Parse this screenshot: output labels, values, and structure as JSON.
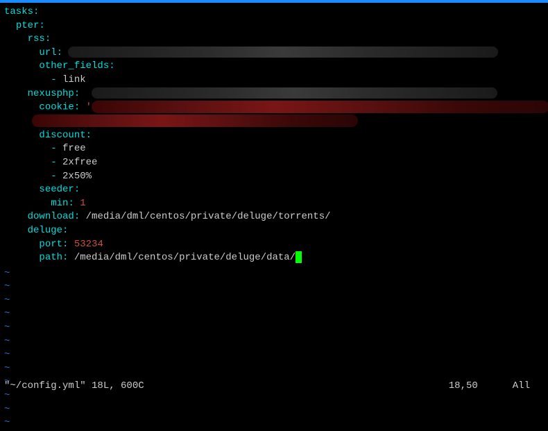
{
  "yaml": {
    "tasks": {
      "key": "tasks",
      "pter": {
        "key": "pter",
        "rss": {
          "key": "rss",
          "url": {
            "key": "url",
            "value": ""
          },
          "other_fields": {
            "key": "other_fields",
            "items": [
              "link"
            ]
          }
        },
        "nexusphp": {
          "key": "nexusphp",
          "cookie": {
            "key": "cookie",
            "value": "'"
          },
          "discount": {
            "key": "discount",
            "items": [
              "free",
              "2xfree",
              "2x50%"
            ]
          },
          "seeder": {
            "key": "seeder",
            "min": {
              "key": "min",
              "value": "1"
            }
          }
        },
        "download": {
          "key": "download",
          "value": "/media/dml/centos/private/deluge/torrents/"
        },
        "deluge": {
          "key": "deluge",
          "port": {
            "key": "port",
            "value": "53234"
          },
          "path": {
            "key": "path",
            "value": "/media/dml/centos/private/deluge/data/"
          }
        }
      }
    }
  },
  "tilde": "~",
  "statusbar": {
    "file": "\"~/config.yml\" 18L, 600C",
    "position": "18,50",
    "view": "All"
  }
}
